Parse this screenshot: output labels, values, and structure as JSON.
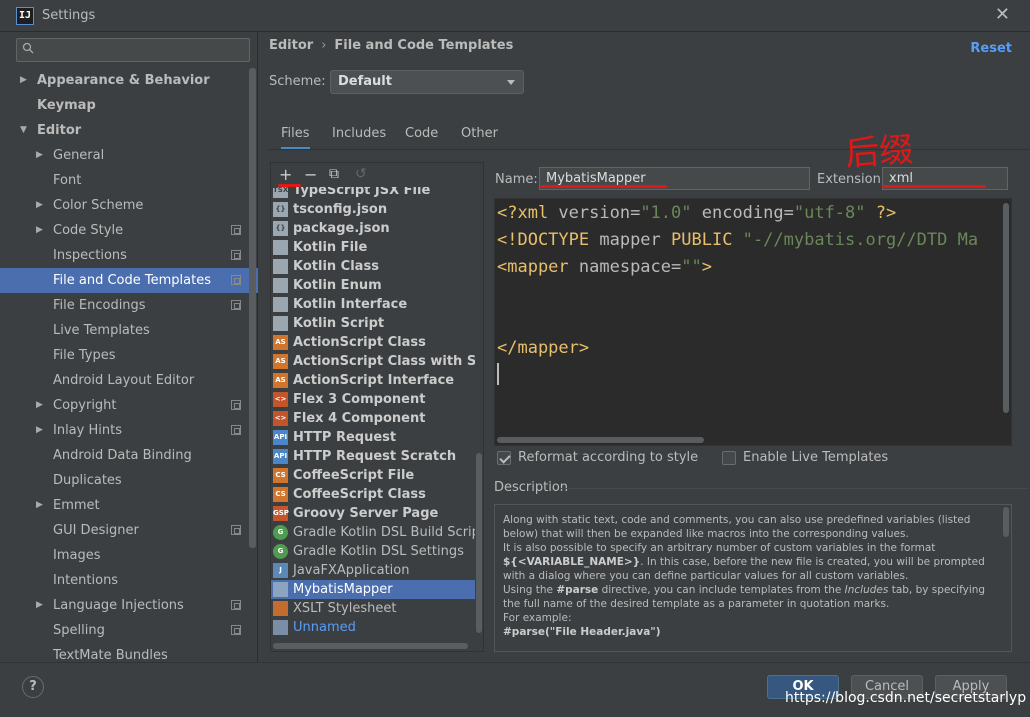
{
  "window": {
    "title": "Settings",
    "icon": "IJ"
  },
  "search": {
    "placeholder": ""
  },
  "sidebar": {
    "items": [
      {
        "label": "Appearance & Behavior",
        "level": 0,
        "arrow": "right",
        "bold": true
      },
      {
        "label": "Keymap",
        "level": 0,
        "arrow": "",
        "bold": true
      },
      {
        "label": "Editor",
        "level": 0,
        "arrow": "down",
        "bold": true
      },
      {
        "label": "General",
        "level": 1,
        "arrow": "right"
      },
      {
        "label": "Font",
        "level": 1,
        "arrow": ""
      },
      {
        "label": "Color Scheme",
        "level": 1,
        "arrow": "right"
      },
      {
        "label": "Code Style",
        "level": 1,
        "arrow": "right",
        "project": true
      },
      {
        "label": "Inspections",
        "level": 1,
        "arrow": "",
        "project": true
      },
      {
        "label": "File and Code Templates",
        "level": 1,
        "arrow": "",
        "project": true,
        "selected": true
      },
      {
        "label": "File Encodings",
        "level": 1,
        "arrow": "",
        "project": true
      },
      {
        "label": "Live Templates",
        "level": 1,
        "arrow": ""
      },
      {
        "label": "File Types",
        "level": 1,
        "arrow": ""
      },
      {
        "label": "Android Layout Editor",
        "level": 1,
        "arrow": ""
      },
      {
        "label": "Copyright",
        "level": 1,
        "arrow": "right",
        "project": true
      },
      {
        "label": "Inlay Hints",
        "level": 1,
        "arrow": "right",
        "project": true
      },
      {
        "label": "Android Data Binding",
        "level": 1,
        "arrow": ""
      },
      {
        "label": "Duplicates",
        "level": 1,
        "arrow": ""
      },
      {
        "label": "Emmet",
        "level": 1,
        "arrow": "right"
      },
      {
        "label": "GUI Designer",
        "level": 1,
        "arrow": "",
        "project": true
      },
      {
        "label": "Images",
        "level": 1,
        "arrow": ""
      },
      {
        "label": "Intentions",
        "level": 1,
        "arrow": ""
      },
      {
        "label": "Language Injections",
        "level": 1,
        "arrow": "right",
        "project": true
      },
      {
        "label": "Spelling",
        "level": 1,
        "arrow": "",
        "project": true
      },
      {
        "label": "TextMate Bundles",
        "level": 1,
        "arrow": ""
      }
    ]
  },
  "breadcrumb": {
    "parent": "Editor",
    "separator": "›",
    "current": "File and Code Templates"
  },
  "reset_label": "Reset",
  "scheme": {
    "label": "Scheme:",
    "value": "Default"
  },
  "tabs": [
    {
      "label": "Files",
      "active": true
    },
    {
      "label": "Includes"
    },
    {
      "label": "Code"
    },
    {
      "label": "Other"
    }
  ],
  "toolbar": {
    "add": "+",
    "remove": "−",
    "copy": "⧉",
    "reset": "↺"
  },
  "files": [
    {
      "name": "TypeScript JSX File",
      "icon": "TSX",
      "kind": "doc",
      "bold": true
    },
    {
      "name": "tsconfig.json",
      "icon": "{}",
      "kind": "doc",
      "bold": true
    },
    {
      "name": "package.json",
      "icon": "{}",
      "kind": "doc",
      "bold": true
    },
    {
      "name": "Kotlin File",
      "icon": "",
      "kind": "doc",
      "bold": true
    },
    {
      "name": "Kotlin Class",
      "icon": "",
      "kind": "doc",
      "bold": true
    },
    {
      "name": "Kotlin Enum",
      "icon": "",
      "kind": "doc",
      "bold": true
    },
    {
      "name": "Kotlin Interface",
      "icon": "",
      "kind": "doc",
      "bold": true
    },
    {
      "name": "Kotlin Script",
      "icon": "",
      "kind": "doc",
      "bold": true
    },
    {
      "name": "ActionScript Class",
      "icon": "AS",
      "kind": "as",
      "bold": true
    },
    {
      "name": "ActionScript Class with Supers",
      "icon": "AS",
      "kind": "as",
      "bold": true
    },
    {
      "name": "ActionScript Interface",
      "icon": "AS",
      "kind": "as",
      "bold": true
    },
    {
      "name": "Flex 3 Component",
      "icon": "<>",
      "kind": "flex",
      "bold": true
    },
    {
      "name": "Flex 4 Component",
      "icon": "<>",
      "kind": "flex",
      "bold": true
    },
    {
      "name": "HTTP Request",
      "icon": "API",
      "kind": "api",
      "bold": true
    },
    {
      "name": "HTTP Request Scratch",
      "icon": "API",
      "kind": "api",
      "bold": true
    },
    {
      "name": "CoffeeScript File",
      "icon": "CS",
      "kind": "coffee",
      "bold": true
    },
    {
      "name": "CoffeeScript Class",
      "icon": "CS",
      "kind": "coffee",
      "bold": true
    },
    {
      "name": "Groovy Server Page",
      "icon": "GSP",
      "kind": "groovy",
      "bold": true
    },
    {
      "name": "Gradle Kotlin DSL Build Script",
      "icon": "G",
      "kind": "gradle",
      "bold": false
    },
    {
      "name": "Gradle Kotlin DSL Settings",
      "icon": "G",
      "kind": "gradle",
      "bold": false
    },
    {
      "name": "JavaFXApplication",
      "icon": "J",
      "kind": "java",
      "bold": false
    },
    {
      "name": "MybatisMapper",
      "icon": "",
      "kind": "mb",
      "bold": false,
      "selected": true
    },
    {
      "name": "XSLT Stylesheet",
      "icon": "",
      "kind": "xslt",
      "bold": false
    },
    {
      "name": "Unnamed",
      "icon": "",
      "kind": "un",
      "bold": false,
      "link": true
    }
  ],
  "name_field": {
    "label": "Name:",
    "value": "MybatisMapper"
  },
  "extension_field": {
    "label": "Extension:",
    "value": "xml"
  },
  "annotation": "后缀",
  "code": [
    "<?xml version=\"1.0\" encoding=\"utf-8\" ?>",
    "<!DOCTYPE mapper PUBLIC \"-//mybatis.org//DTD Ma",
    "<mapper namespace=\"\">",
    "",
    "",
    "</mapper>"
  ],
  "options": {
    "reformat": {
      "label": "Reformat according to style",
      "checked": true
    },
    "live_templates": {
      "label": "Enable Live Templates",
      "checked": false
    }
  },
  "description": {
    "label": "Description",
    "p1": "Along with static text, code and comments, you can also use predefined variables (listed below) that will then be expanded like macros into the corresponding values.",
    "p2a": "It is also possible to specify an arbitrary number of custom variables in the format ",
    "p2b": "${<VARIABLE_NAME>}",
    "p2c": ". In this case, before the new file is created, you will be prompted with a dialog where you can define particular values for all custom variables.",
    "p3a": "Using the ",
    "p3b": "#parse",
    "p3c": " directive, you can include templates from the ",
    "p3d": "Includes",
    "p3e": " tab, by specifying the full name of the desired template as a parameter in quotation marks.",
    "p4": "For example:",
    "p5": "#parse(\"File Header.java\")"
  },
  "footer": {
    "help": "?",
    "ok": "OK",
    "cancel": "Cancel",
    "apply": "Apply",
    "watermark": "https://blog.csdn.net/secretstarlyp"
  },
  "colors": {
    "accent": "#4b6eaf",
    "link": "#589df6",
    "annotation_red": "#e01818"
  }
}
